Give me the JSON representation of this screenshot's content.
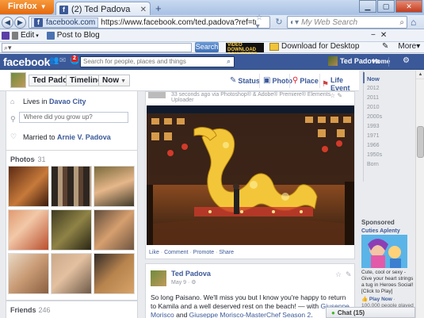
{
  "browser": {
    "app_button": "Firefox",
    "tab_title": "(2) Ted Padova",
    "site_badge": "facebook.com",
    "url": "https://www.facebook.com/ted.padova?ref=tn_tnmn",
    "search_placeholder": "My Web Search",
    "menu_items": [
      {
        "label": "Edit"
      },
      {
        "label": "Post to Blog"
      }
    ],
    "menu_right": "More",
    "toolbar": {
      "search_button": "Search",
      "converter_logo": "VIDEO DOWNLOAD CONVERTER",
      "download_link": "Download for Desktop",
      "right_label": "More"
    }
  },
  "fb": {
    "logo": "facebook",
    "search_placeholder": "Search for people, places and things",
    "notif_count": "2",
    "user_name": "Ted Padova",
    "home": "Home"
  },
  "timeline": {
    "name": "Ted Padova",
    "timeline_label": "Timeline",
    "now_label": "Now",
    "post_types": [
      {
        "icon": "status-icon",
        "label": "Status"
      },
      {
        "icon": "photo-icon",
        "label": "Photo"
      },
      {
        "icon": "place-icon",
        "label": "Place"
      },
      {
        "icon": "life-event-icon",
        "label": "Life Event"
      }
    ]
  },
  "about": {
    "lives_prefix": "Lives in",
    "lives_city": "Davao City",
    "grew_placeholder": "Where did you grow up?",
    "married_prefix": "Married to",
    "married_name": "Arnie V. Padova"
  },
  "photos": {
    "title": "Photos",
    "count": "· 31"
  },
  "friends": {
    "title": "Friends",
    "count": "· 246"
  },
  "post1": {
    "meta": "33 seconds ago via Photoshop® & Adobe® Premiere® Elements Uploader",
    "actions": [
      "Like",
      "Comment",
      "Promote",
      "Share"
    ]
  },
  "post2": {
    "name": "Ted Padova",
    "date": "May 9 · ",
    "text_part1": "So long Paisano. We'll miss you but I know you're happy to return to Kamila and a well deserved rest on the beach! — with ",
    "mention1": "Giuseppe Morisco",
    "text_and": " and ",
    "mention2": "Giuseppe Morisco-MasterChef Season 2",
    "text_end": "."
  },
  "years": [
    "Now",
    "2012",
    "2011",
    "2010",
    "2000s",
    "1993",
    "1971",
    "1966",
    "1950s",
    "Born"
  ],
  "sponsored": {
    "title": "Sponsored",
    "ad_title": "Cuties Aplenty",
    "desc": "Cute, cool or sexy - Give your heart strings a tug in Heroes Social! [Click to Play]",
    "play_now": "Play Now",
    "play_rest": " · 100,000 people played Heroes Social (PH)."
  },
  "chat": {
    "label": "Chat (15)"
  },
  "colors": {
    "fb_blue": "#3b5998",
    "firefox_orange": "#e66000"
  }
}
